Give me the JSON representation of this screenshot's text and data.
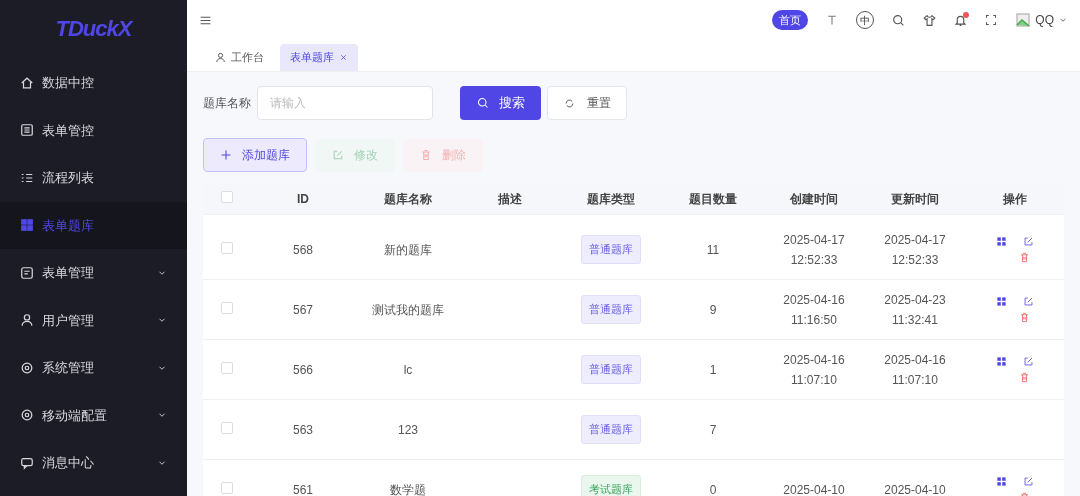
{
  "logo": "TDuckX",
  "sidebar": {
    "items": [
      {
        "label": "数据中控",
        "selected": false,
        "has_submenu": false
      },
      {
        "label": "表单管控",
        "selected": false,
        "has_submenu": false
      },
      {
        "label": "流程列表",
        "selected": false,
        "has_submenu": false
      },
      {
        "label": "表单题库",
        "selected": true,
        "has_submenu": false
      },
      {
        "label": "表单管理",
        "selected": false,
        "has_submenu": true
      },
      {
        "label": "用户管理",
        "selected": false,
        "has_submenu": true
      },
      {
        "label": "系统管理",
        "selected": false,
        "has_submenu": true
      },
      {
        "label": "移动端配置",
        "selected": false,
        "has_submenu": true
      },
      {
        "label": "消息中心",
        "selected": false,
        "has_submenu": true
      }
    ]
  },
  "header": {
    "home_button": "首页",
    "language": "中",
    "notification_dot": true,
    "user": "QQ"
  },
  "tabs": [
    {
      "label": "工作台",
      "selected": false,
      "closable": false
    },
    {
      "label": "表单题库",
      "selected": true,
      "closable": true
    }
  ],
  "search": {
    "label": "题库名称",
    "placeholder": "请输入",
    "search_button": "搜索",
    "reset_button": "重置"
  },
  "toolbar": [
    {
      "kind": "add",
      "label": "添加题库",
      "disabled": false
    },
    {
      "kind": "edit",
      "label": "修改",
      "disabled": true
    },
    {
      "kind": "delete",
      "label": "删除",
      "disabled": true
    }
  ],
  "table": {
    "header_checked": false,
    "columns": [
      "ID",
      "题库名称",
      "描述",
      "题库类型",
      "题目数量",
      "创建时间",
      "更新时间",
      "操作"
    ],
    "rows": [
      {
        "checked": false,
        "id": "568",
        "name": "新的题库",
        "type": {
          "label": "普通题库",
          "kind": "normal"
        },
        "count": "11",
        "created": [
          "2025-04-17",
          "12:52:33"
        ],
        "updated": [
          "2025-04-17",
          "12:52:33"
        ],
        "actions": true
      },
      {
        "checked": false,
        "id": "567",
        "name": "测试我的题库",
        "type": {
          "label": "普通题库",
          "kind": "normal"
        },
        "count": "9",
        "created": [
          "2025-04-16",
          "11:16:50"
        ],
        "updated": [
          "2025-04-23",
          "11:32:41"
        ],
        "actions": true
      },
      {
        "checked": false,
        "id": "566",
        "name": "lc",
        "type": {
          "label": "普通题库",
          "kind": "normal"
        },
        "count": "1",
        "created": [
          "2025-04-16",
          "11:07:10"
        ],
        "updated": [
          "2025-04-16",
          "11:07:10"
        ],
        "actions": true
      },
      {
        "checked": false,
        "id": "563",
        "name": "123",
        "type": {
          "label": "普通题库",
          "kind": "normal"
        },
        "count": "7",
        "actions": false
      },
      {
        "checked": false,
        "id": "561",
        "name": "数学题",
        "type": {
          "label": "考试题库",
          "kind": "exam"
        },
        "count": "0",
        "created": [
          "2025-04-10"
        ],
        "updated": [
          "2025-04-10"
        ],
        "actions": true
      }
    ]
  }
}
